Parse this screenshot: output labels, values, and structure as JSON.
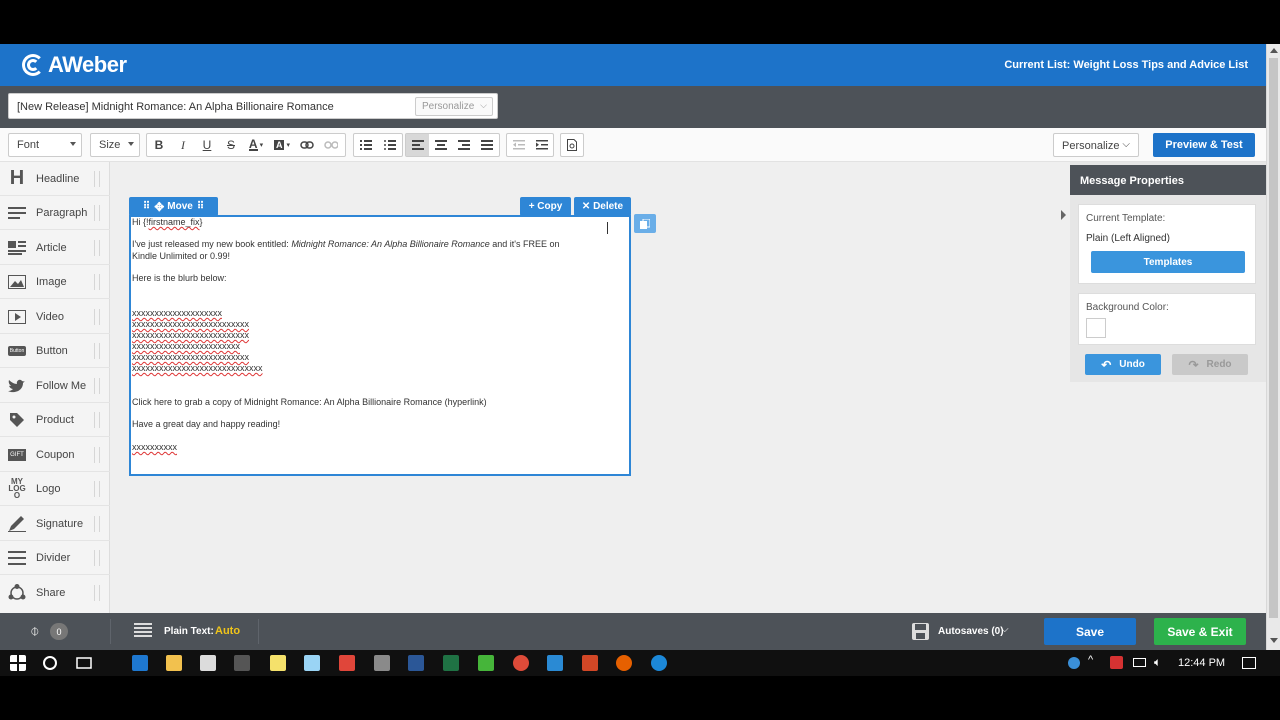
{
  "header": {
    "logo_text": "AWeber",
    "current_list": "Current List: Weight Loss Tips and Advice List"
  },
  "subject": {
    "value": "[New Release] Midnight Romance: An Alpha Billionaire Romance",
    "personalize": "Personalize"
  },
  "toolbar": {
    "font": "Font",
    "size": "Size",
    "personalize": "Personalize",
    "preview_test": "Preview & Test"
  },
  "sidebar": {
    "items": [
      {
        "label": "Headline",
        "icon": "headline-icon"
      },
      {
        "label": "Paragraph",
        "icon": "paragraph-icon"
      },
      {
        "label": "Article",
        "icon": "article-icon"
      },
      {
        "label": "Image",
        "icon": "image-icon"
      },
      {
        "label": "Video",
        "icon": "video-icon"
      },
      {
        "label": "Button",
        "icon": "button-icon"
      },
      {
        "label": "Follow Me",
        "icon": "twitter-icon"
      },
      {
        "label": "Product",
        "icon": "tag-icon"
      },
      {
        "label": "Coupon",
        "icon": "coupon-icon"
      },
      {
        "label": "Logo",
        "icon": "logo-icon"
      },
      {
        "label": "Signature",
        "icon": "pen-icon"
      },
      {
        "label": "Divider",
        "icon": "divider-icon"
      },
      {
        "label": "Share",
        "icon": "share-icon"
      }
    ],
    "button_icon_text": "Button",
    "logo_icon_text": "MY LOGO",
    "coupon_icon_text": "GIFT"
  },
  "block": {
    "move": "Move",
    "copy": "+ Copy",
    "delete": "✕ Delete"
  },
  "editor": {
    "greeting_prefix": "Hi {!",
    "greeting_var": "firstname_fix",
    "greeting_suffix": "}",
    "line1_prefix": "I've just released my new book entitled: ",
    "line1_title": "Midnight Romance: An Alpha Billionaire Romance",
    "line1_suffix": " and it's FREE on",
    "line1_cont": "Kindle Unlimited or 0.99!",
    "line2": "Here is the blurb below:",
    "blurb": [
      "xxxxxxxxxxxxxxxxxxxx",
      "xxxxxxxxxxxxxxxxxxxxxxxxxx",
      "xxxxxxxxxxxxxxxxxxxxxxxxxx",
      "xxxxxxxxxxxxxxxxxxxxxxxx",
      "xxxxxxxxxxxxxxxxxxxxxxxxxx",
      "xxxxxxxxxxxxxxxxxxxxxxxxxxxxx"
    ],
    "line3": "Click here to grab a copy of Midnight Romance: An Alpha Billionaire Romance (hyperlink)",
    "line4": "Have a great day and happy reading!",
    "signoff": "xxxxxxxxxx"
  },
  "props": {
    "title": "Message Properties",
    "current_template_label": "Current Template:",
    "current_template_value": "Plain (Left Aligned)",
    "templates_btn": "Templates",
    "bg_color_label": "Background Color:",
    "bg_color_value": "#ffffff",
    "undo": "Undo",
    "redo": "Redo"
  },
  "footer": {
    "attachments": "0",
    "plain_text_label": "Plain Text:",
    "plain_text_value": "Auto",
    "autosaves": "Autosaves (0)",
    "save": "Save",
    "save_exit": "Save & Exit"
  },
  "taskbar": {
    "time": "12:44 PM"
  },
  "colors": {
    "brand_blue": "#1d73c9",
    "save_exit_green": "#2db24c",
    "auto_yellow": "#f0c419"
  }
}
